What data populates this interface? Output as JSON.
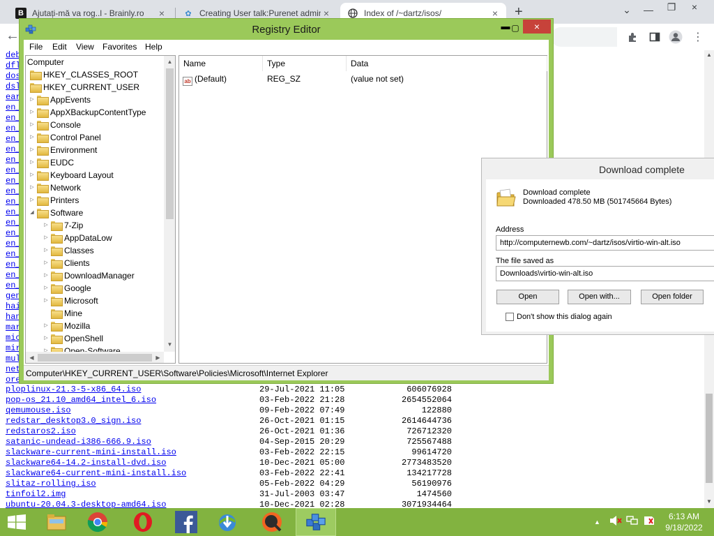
{
  "browser": {
    "tabs": [
      {
        "title": "Ajutați-mă va rog..l - Brainly.ro",
        "icon": "brainly-icon"
      },
      {
        "title": "Creating User talk:Purenet admin",
        "icon": "wiki-icon"
      },
      {
        "title": "Index of /~dartz/isos/",
        "icon": "globe-icon"
      }
    ],
    "new_tab": "+",
    "close": "×"
  },
  "page": {
    "left_links": [
      "deb",
      "dfl",
      "dos",
      "dsl",
      "ear",
      "en_",
      "en_",
      "en_",
      "en_",
      "en_",
      "en_",
      "en_",
      "en_",
      "en_",
      "en_",
      "en_",
      "en_",
      "en_",
      "en_",
      "en_",
      "en_",
      "en_",
      "en_",
      "gen",
      "hai",
      "han",
      "mar",
      "mic",
      "mir",
      "mul",
      "net",
      "ore"
    ],
    "files": [
      {
        "name": "ploplinux-21.3-5-x86_64.iso",
        "date": "29-Jul-2021 11:05",
        "size": "606076928"
      },
      {
        "name": "pop-os_21.10_amd64_intel_6.iso",
        "date": "03-Feb-2022 21:28",
        "size": "2654552064"
      },
      {
        "name": "qemumouse.iso",
        "date": "09-Feb-2022 07:49",
        "size": "122880"
      },
      {
        "name": "redstar_desktop3.0_sign.iso",
        "date": "26-Oct-2021 01:15",
        "size": "2614644736"
      },
      {
        "name": "redstaros2.iso",
        "date": "26-Oct-2021 01:36",
        "size": "726712320"
      },
      {
        "name": "satanic-undead-i386-666.9.iso",
        "date": "04-Sep-2015 20:29",
        "size": "725567488"
      },
      {
        "name": "slackware-current-mini-install.iso",
        "date": "03-Feb-2022 22:15",
        "size": "99614720"
      },
      {
        "name": "slackware64-14.2-install-dvd.iso",
        "date": "10-Dec-2021 05:00",
        "size": "2773483520"
      },
      {
        "name": "slackware64-current-mini-install.iso",
        "date": "03-Feb-2022 22:41",
        "size": "134217728"
      },
      {
        "name": "slitaz-rolling.iso",
        "date": "05-Feb-2022 04:29",
        "size": "56190976"
      },
      {
        "name": "tinfoil2.img",
        "date": "31-Jul-2003 03:47",
        "size": "1474560"
      },
      {
        "name": "ubuntu-20.04.3-desktop-amd64.iso",
        "date": "10-Dec-2021 02:28",
        "size": "3071934464"
      }
    ]
  },
  "regedit": {
    "title": "Registry Editor",
    "menu": [
      "File",
      "Edit",
      "View",
      "Favorites",
      "Help"
    ],
    "tree": {
      "root": "Computer",
      "hives": [
        "HKEY_CLASSES_ROOT",
        "HKEY_CURRENT_USER"
      ],
      "hkcu_children": [
        "AppEvents",
        "AppXBackupContentType",
        "Console",
        "Control Panel",
        "Environment",
        "EUDC",
        "Keyboard Layout",
        "Network",
        "Printers",
        "Software"
      ],
      "software_children": [
        "7-Zip",
        "AppDataLow",
        "Classes",
        "Clients",
        "DownloadManager",
        "Google",
        "Microsoft",
        "Mine",
        "Mozilla",
        "OpenShell",
        "Open-Software"
      ]
    },
    "columns": [
      "Name",
      "Type",
      "Data"
    ],
    "values": [
      {
        "name": "(Default)",
        "type": "REG_SZ",
        "data": "(value not set)"
      }
    ],
    "status": "Computer\\HKEY_CURRENT_USER\\Software\\Policies\\Microsoft\\Internet Explorer"
  },
  "download": {
    "title": "Download complete",
    "heading": "Download complete",
    "detail": "Downloaded 478.50  MB (501745664 Bytes)",
    "address_label": "Address",
    "address": "http://computernewb.com/~dartz/isos/virtio-win-alt.iso",
    "saved_label": "The file saved as",
    "saved_path": "Downloads\\virtio-win-alt.iso",
    "buttons": {
      "open": "Open",
      "open_with": "Open with...",
      "open_folder": "Open folder"
    },
    "checkbox_label": "Don't show this dialog again"
  },
  "taskbar": {
    "time": "6:13 AM",
    "date": "9/18/2022"
  }
}
